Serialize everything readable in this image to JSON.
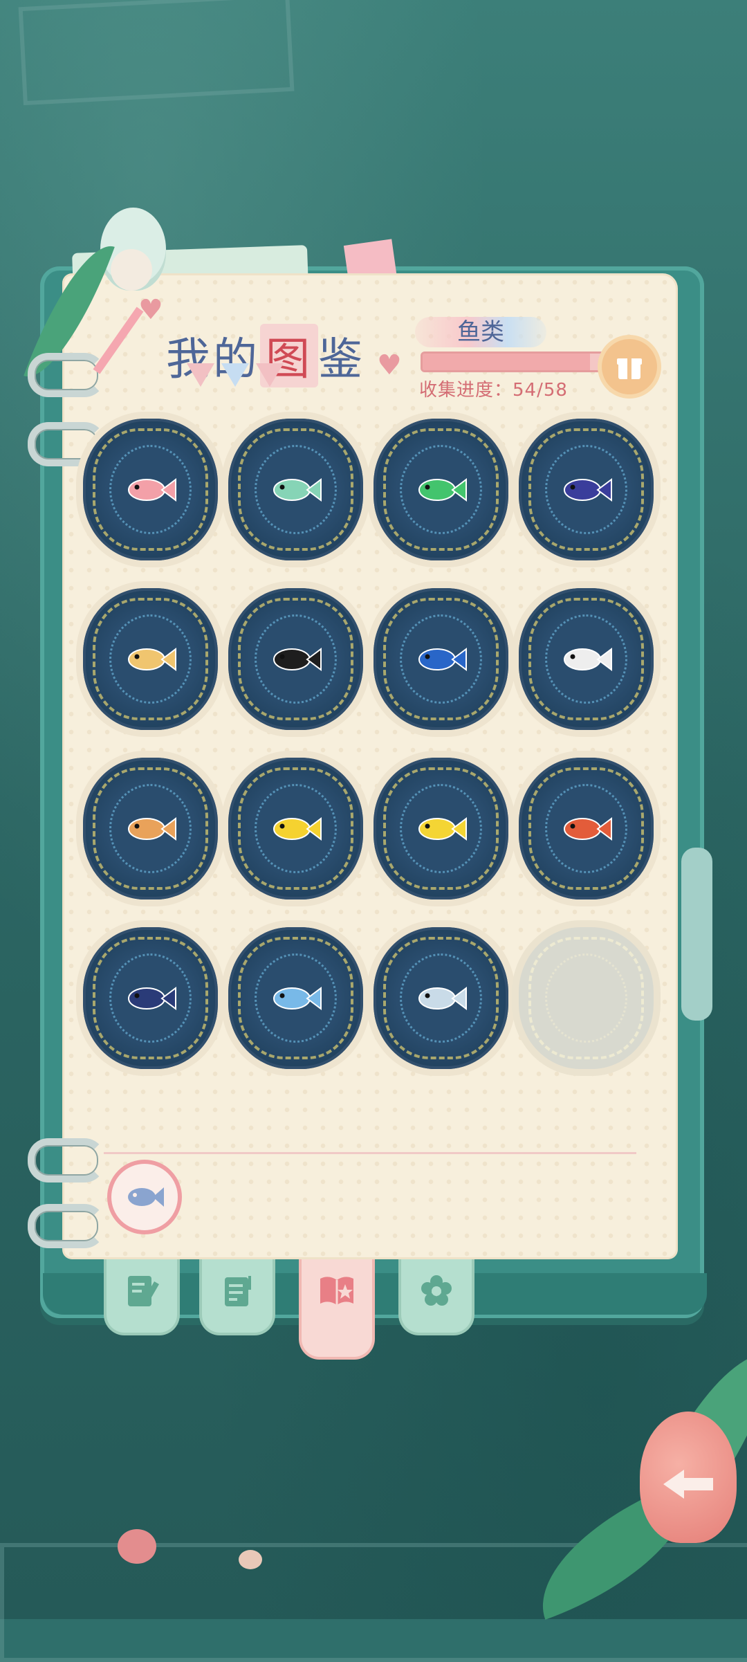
{
  "screen": {
    "title_prefix": "我的",
    "title_highlight": "图",
    "title_suffix": "鉴"
  },
  "category": {
    "label": "鱼类"
  },
  "progress": {
    "label": "收集进度：54/58",
    "collected": 54,
    "total": 58,
    "fraction": 0.931
  },
  "slots": [
    {
      "fish": "pink-squirrelfish",
      "color": "#f3a0a8",
      "unlocked": true
    },
    {
      "fish": "green-parrotfish",
      "color": "#86d4b6",
      "unlocked": true
    },
    {
      "fish": "green-wrasse",
      "color": "#43c46d",
      "unlocked": true
    },
    {
      "fish": "purple-tang",
      "color": "#3a3d9b",
      "unlocked": true
    },
    {
      "fish": "pufferfish",
      "color": "#f0c56f",
      "unlocked": true
    },
    {
      "fish": "moorish-idol",
      "color": "#1e1e1e",
      "unlocked": true
    },
    {
      "fish": "blue-tang",
      "color": "#2966c8",
      "unlocked": true
    },
    {
      "fish": "black-white-angelfish",
      "color": "#eeeeee",
      "unlocked": true
    },
    {
      "fish": "clown-grouper",
      "color": "#e9a25a",
      "unlocked": true
    },
    {
      "fish": "yellow-butterflyfish",
      "color": "#f5d230",
      "unlocked": true
    },
    {
      "fish": "yellow-tang",
      "color": "#f4d534",
      "unlocked": true
    },
    {
      "fish": "red-striped-fish",
      "color": "#e35c3a",
      "unlocked": true
    },
    {
      "fish": "emperor-angelfish",
      "color": "#2a3b78",
      "unlocked": true
    },
    {
      "fish": "blue-discus",
      "color": "#78b9e8",
      "unlocked": true
    },
    {
      "fish": "spotted-grouper",
      "color": "#c9dbe8",
      "unlocked": true
    },
    {
      "fish": "locked",
      "color": "#d8d9cf",
      "unlocked": false
    }
  ],
  "tabs": [
    {
      "name": "tab-notes",
      "icon": "notebook-pencil-icon",
      "active": false
    },
    {
      "name": "tab-journal",
      "icon": "journal-icon",
      "active": false
    },
    {
      "name": "tab-collection",
      "icon": "book-star-icon",
      "active": true
    },
    {
      "name": "tab-flower",
      "icon": "flower-icon",
      "active": false
    }
  ],
  "colors": {
    "accent": "#e59d9d",
    "title": "#4e6698",
    "panel": "#f7efdc"
  }
}
